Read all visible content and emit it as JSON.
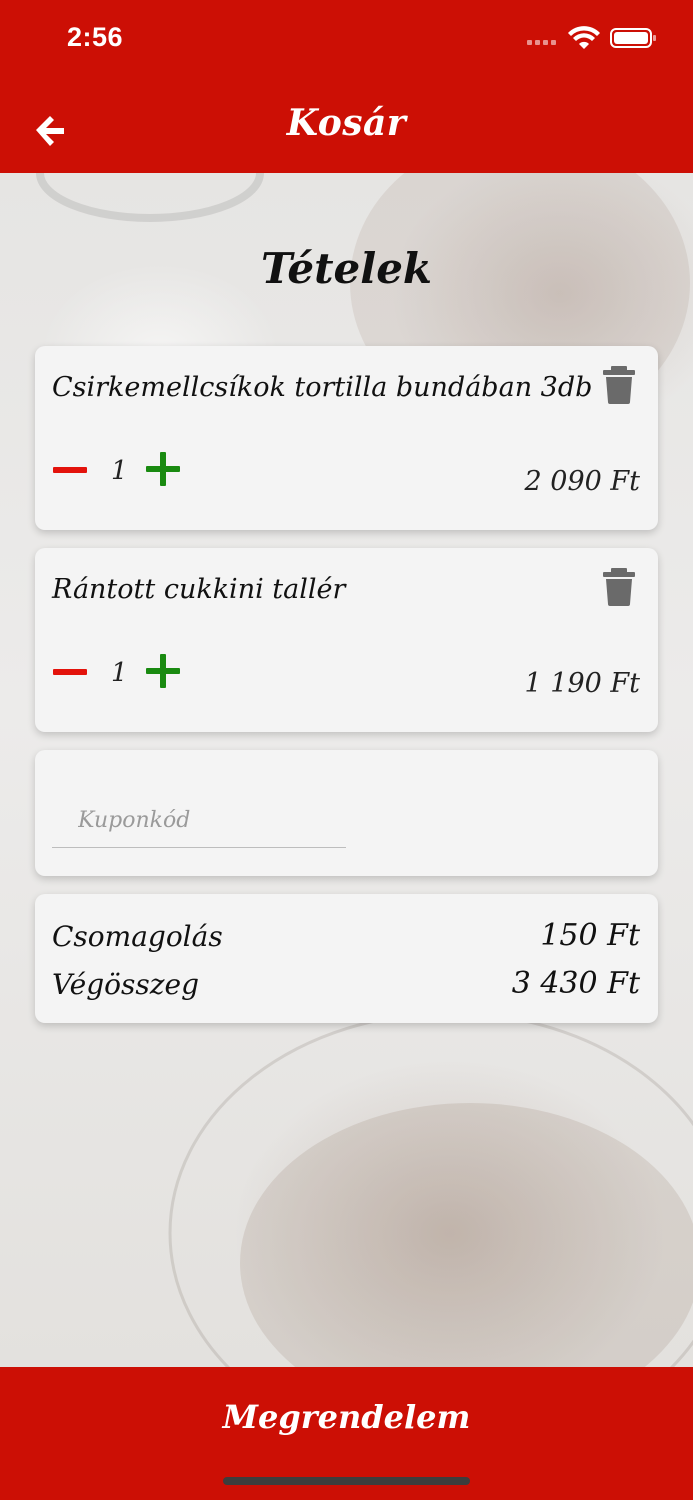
{
  "status_bar": {
    "time": "2:56"
  },
  "header": {
    "title": "Kosár",
    "back_icon": "arrow-left-icon"
  },
  "section_title": "Tételek",
  "cart_items": [
    {
      "name": "Csirkemellcsíkok tortilla bundában  3db",
      "quantity": "1",
      "price": "2 090 Ft"
    },
    {
      "name": "Rántott cukkini tallér",
      "quantity": "1",
      "price": "1 190 Ft"
    }
  ],
  "coupon": {
    "placeholder": "Kuponkód",
    "value": ""
  },
  "summary": {
    "packaging_label": "Csomagolás",
    "packaging_value": "150 Ft",
    "total_label": "Végösszeg",
    "total_value": "3 430 Ft"
  },
  "order_button": {
    "label": "Megrendelem"
  },
  "colors": {
    "brand_red": "#cc0f05",
    "minus_red": "#e3120b",
    "plus_green": "#198a10",
    "card_bg": "#f4f4f4"
  }
}
